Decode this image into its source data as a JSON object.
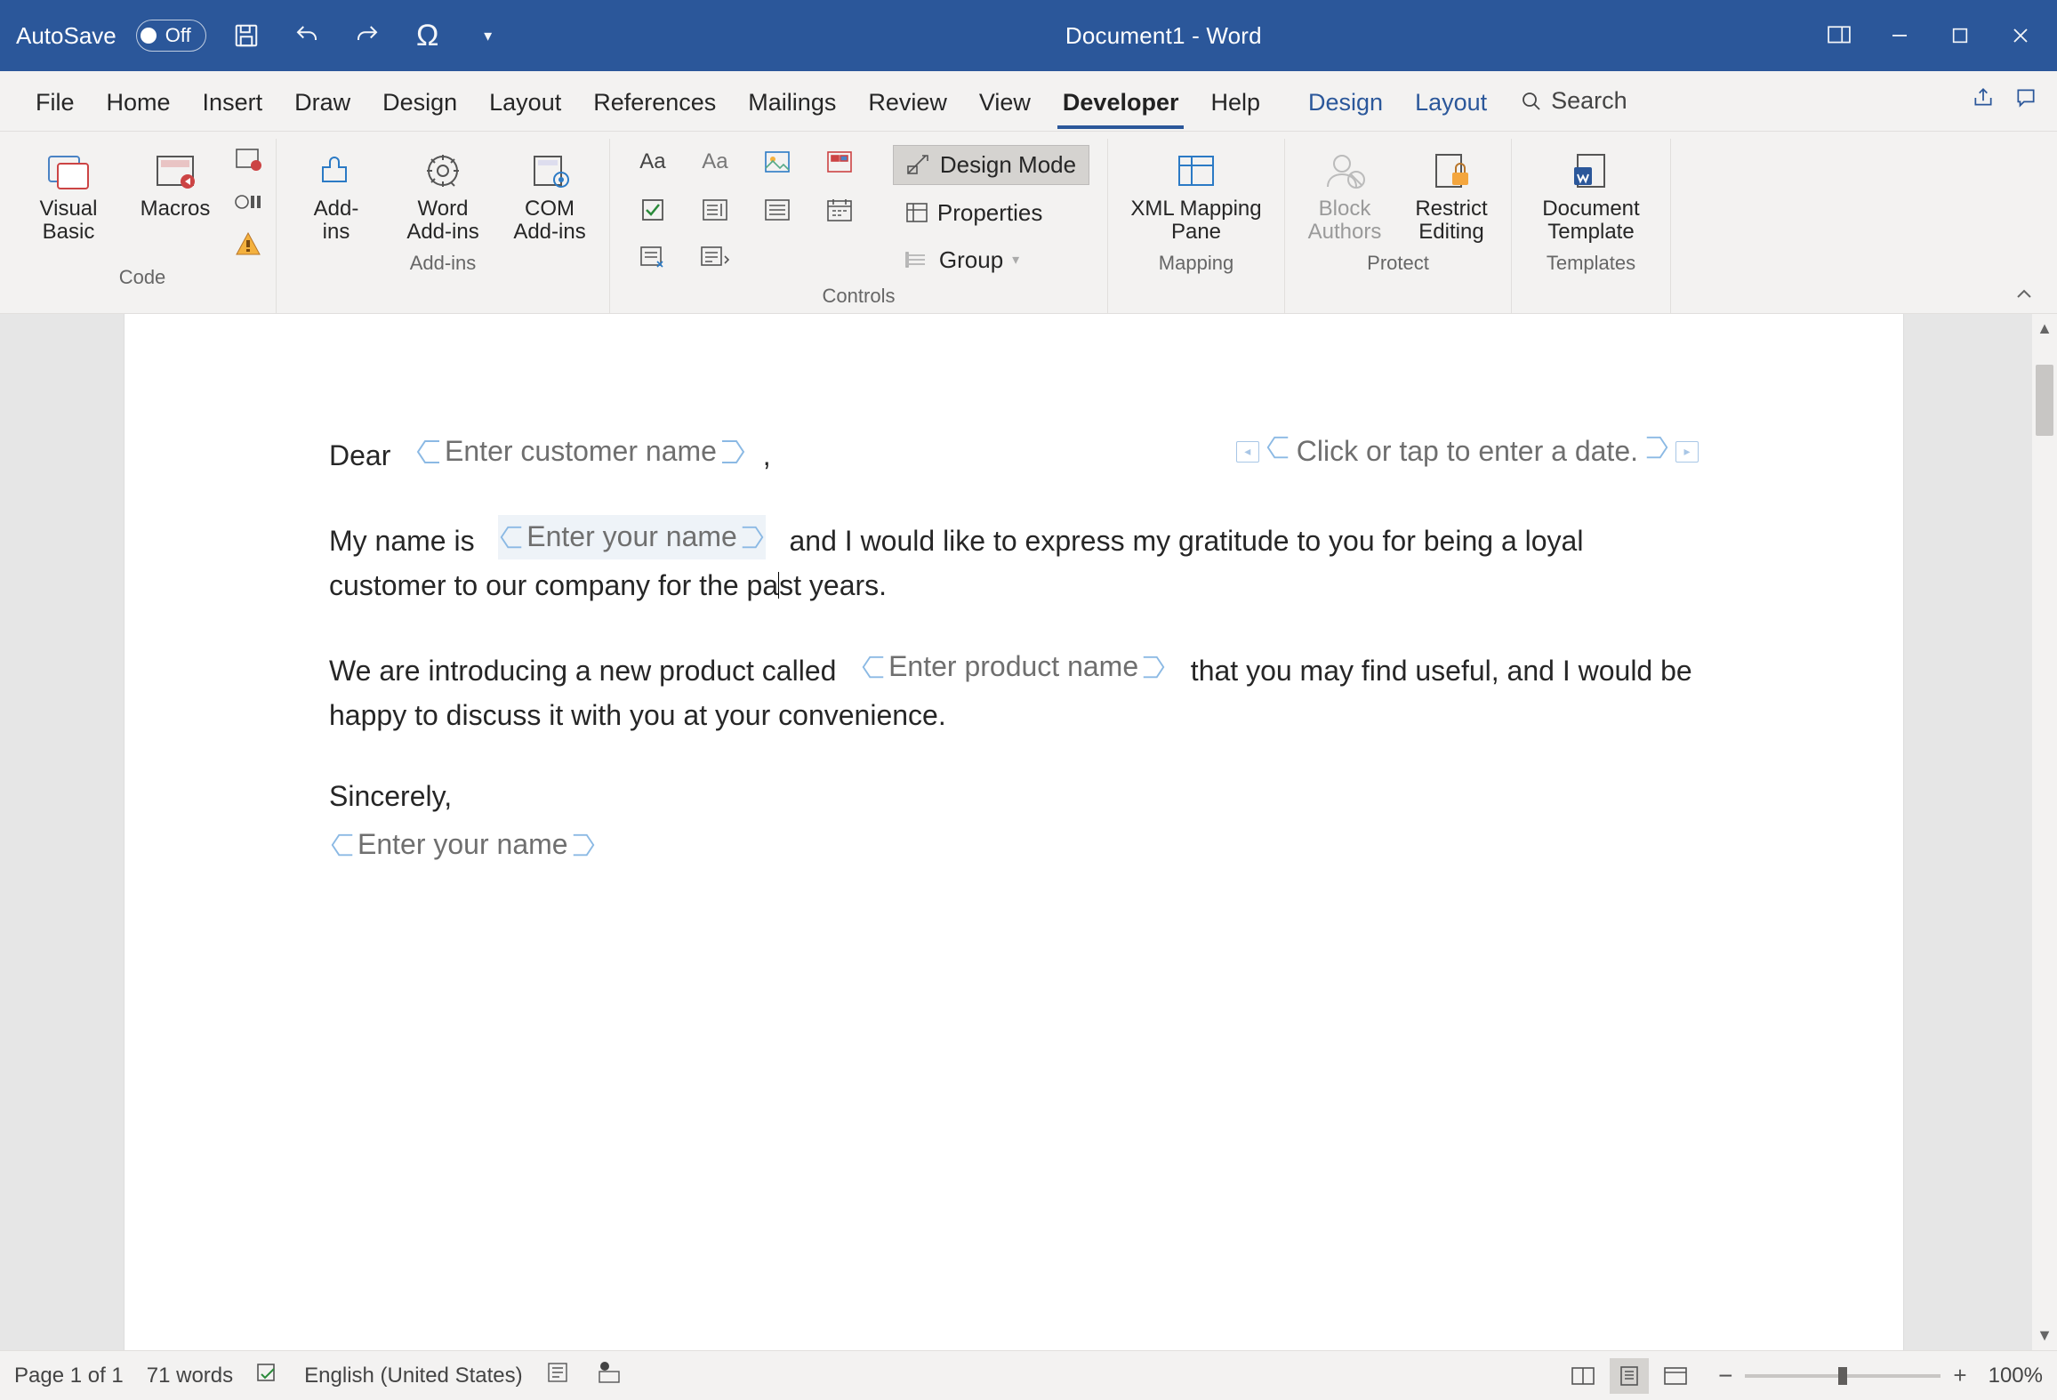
{
  "titlebar": {
    "autosave_label": "AutoSave",
    "autosave_state": "Off",
    "doc_title": "Document1  -  Word"
  },
  "tabs": {
    "items": [
      "File",
      "Home",
      "Insert",
      "Draw",
      "Design",
      "Layout",
      "References",
      "Mailings",
      "Review",
      "View",
      "Developer",
      "Help"
    ],
    "extra": [
      "Design",
      "Layout"
    ],
    "search_label": "Search",
    "active": "Developer"
  },
  "ribbon": {
    "code": {
      "label": "Code",
      "visual_basic": "Visual\nBasic",
      "macros": "Macros"
    },
    "addins": {
      "label": "Add-ins",
      "addins_btn": "Add-\nins",
      "word_addins": "Word\nAdd-ins",
      "com_addins": "COM\nAdd-ins"
    },
    "controls": {
      "label": "Controls",
      "design_mode": "Design Mode",
      "properties": "Properties",
      "group": "Group"
    },
    "mapping": {
      "label": "Mapping",
      "xml_pane": "XML Mapping\nPane"
    },
    "protect": {
      "label": "Protect",
      "block_authors": "Block\nAuthors",
      "restrict": "Restrict\nEditing"
    },
    "templates": {
      "label": "Templates",
      "doc_template": "Document\nTemplate"
    }
  },
  "document": {
    "dear": "Dear",
    "cc_customer": "Enter customer name",
    "comma": ",",
    "cc_date": "Click or tap to enter a date.",
    "p2a": "My name is",
    "cc_yourname": "Enter your name",
    "p2b": "and I would like to express my gratitude to you for being a loyal customer to our company for the pa",
    "p2c": "st years.",
    "p3a": "We are introducing a new product called",
    "cc_product": "Enter product name",
    "p3b": "that you may find useful, and I would be happy to discuss it with you at your convenience.",
    "p4": "Sincerely,",
    "cc_sign": "Enter your name"
  },
  "status": {
    "page": "Page 1 of 1",
    "words": "71 words",
    "language": "English (United States)",
    "zoom": "100%"
  }
}
